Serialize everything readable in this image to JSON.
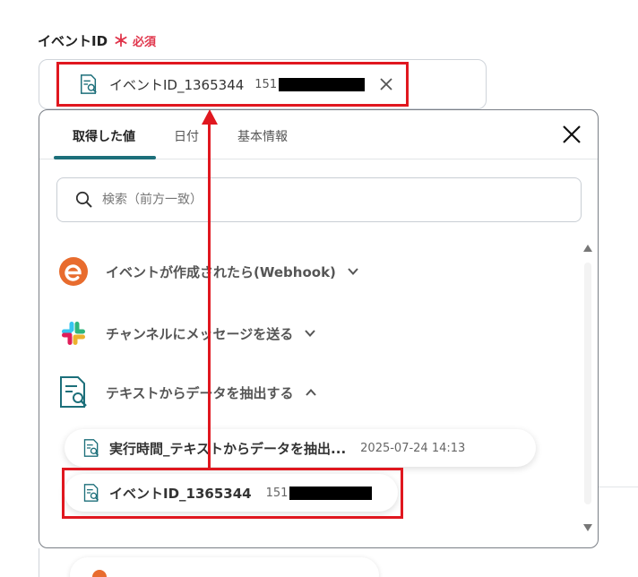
{
  "field": {
    "label": "イベントID",
    "required_star": "＊",
    "required_text": "必須"
  },
  "selected_chip": {
    "label": "イベントID_1365344",
    "value_prefix": "151"
  },
  "dropdown": {
    "tabs": [
      {
        "label": "取得した値",
        "active": true
      },
      {
        "label": "日付",
        "active": false
      },
      {
        "label": "基本情報",
        "active": false
      }
    ],
    "search": {
      "placeholder": "検索（前方一致）"
    },
    "sections": [
      {
        "label": "イベントが作成されたら(Webhook)",
        "icon": "eventbrite-logo-icon",
        "expanded": false
      },
      {
        "label": "チャンネルにメッセージを送る",
        "icon": "slack-logo-icon",
        "expanded": false
      },
      {
        "label": "テキストからデータを抽出する",
        "icon": "document-search-icon",
        "expanded": true
      }
    ],
    "results": [
      {
        "label": "実行時間_テキストからデータを抽出...",
        "value": "2025-07-24 14:13"
      },
      {
        "label": "イベントID_1365344",
        "value_prefix": "151"
      }
    ]
  },
  "colors": {
    "highlight": "#e0171f",
    "required": "#e0354b",
    "tab_accent": "#1c6f7a",
    "doc_icon": "#1c6f7a",
    "eventbrite": "#e86c2e"
  }
}
